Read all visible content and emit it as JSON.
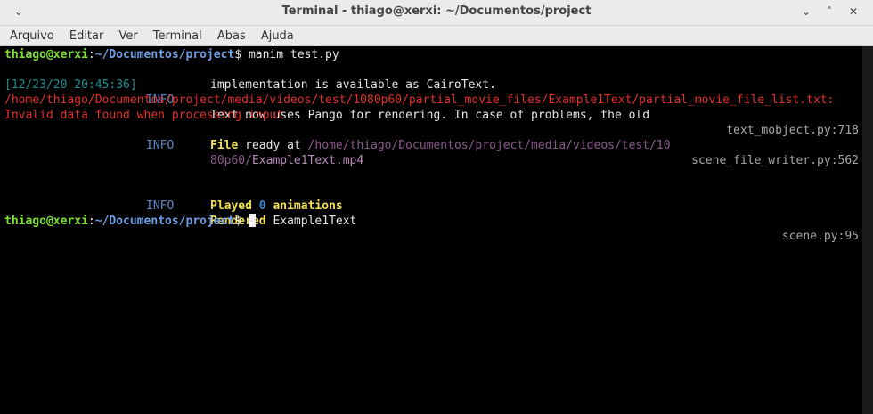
{
  "window": {
    "title": "Terminal - thiago@xerxi: ~/Documentos/project"
  },
  "menu": [
    "Arquivo",
    "Editar",
    "Ver",
    "Terminal",
    "Abas",
    "Ajuda"
  ],
  "terminal": {
    "prompt_user": "thiago@xerxi",
    "prompt_sep": ":",
    "prompt_path": "~/Documentos/project",
    "prompt_symbol": "$",
    "command": " manim test.py",
    "l1_time": "[12/23/20 20:45:36]",
    "info": "INFO",
    "l1_msg": "Text now uses Pango for rendering. In case of problems, the old",
    "l1_source": "text_mobject.py:718",
    "l2_msg": "implementation is available as CairoText.",
    "error_line1": "/home/thiago/Documentos/project/media/videos/test/1080p60/partial_movie_files/Example1Text/partial_movie_file_list.txt:",
    "error_line2": "Invalid data found when processing input",
    "l5_source": "scene_file_writer.py:562",
    "l6_file": "File",
    "l6_ready": " ready at ",
    "l6_path": "/home/thiago/Documentos/project/media/videos/test/10",
    "l7_path": "80p60/",
    "l7_file": "Example1Text.mp4",
    "l9_rendered": "Rendered",
    "l9_name": " Example1Text",
    "l9_source": "scene.py:95",
    "l10_played": "Played",
    "l10_count": "0",
    "l10_anim": "animations"
  }
}
